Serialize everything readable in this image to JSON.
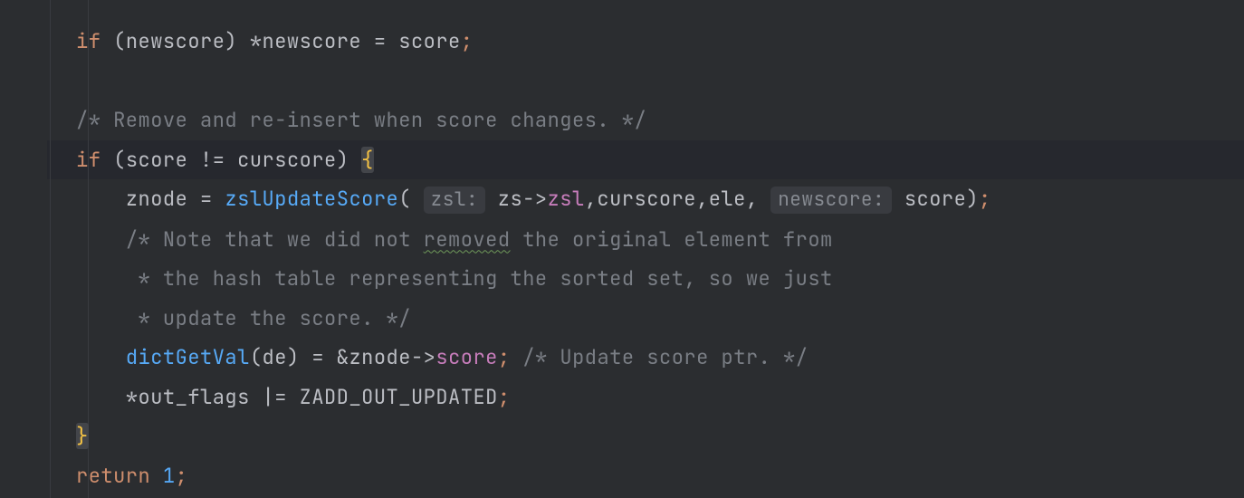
{
  "code": {
    "l1": {
      "if": "if",
      "open": "(",
      "id": "newscore",
      "close": ")",
      "star": " *",
      "id2": "newscore",
      "eq": " = ",
      "id3": "score",
      "semi": ";"
    },
    "l3": {
      "comment": "/* Remove and re-insert when score changes. */"
    },
    "l4": {
      "if": "if",
      "open": "(",
      "id1": "score",
      "neq": " != ",
      "id2": "curscore",
      "close": ") ",
      "brace": "{"
    },
    "l5": {
      "id1": "znode",
      "eq": " = ",
      "fn": "zslUpdateScore",
      "open": "(",
      "hint1": "zsl:",
      "id2": "zs",
      "arrow": "->",
      "mem": "zsl",
      "args": ",curscore,ele,",
      "hint2": "newscore:",
      "id3": "score",
      "close": ")",
      "semi": ";"
    },
    "l6": {
      "c1": "/* Note that we did not ",
      "wavy": "removed",
      "c2": " the original element from"
    },
    "l7": {
      "comment": " * the hash table representing the sorted set, so we just"
    },
    "l8": {
      "comment": " * update the score. */"
    },
    "l9": {
      "fn": "dictGetVal",
      "open": "(",
      "arg": "de",
      "close": ")",
      "eq": " = &",
      "id": "znode",
      "arrow": "->",
      "mem": "score",
      "semi": ";",
      "sp": " ",
      "com": "/* Update score ptr. */"
    },
    "l10": {
      "star": "*",
      "id": "out_flags",
      "op": " |= ",
      "id2": "ZADD_OUT_UPDATED",
      "semi": ";"
    },
    "l11": {
      "brace": "}"
    },
    "l12": {
      "ret": "return",
      "sp": " ",
      "num": "1",
      "semi": ";"
    }
  }
}
